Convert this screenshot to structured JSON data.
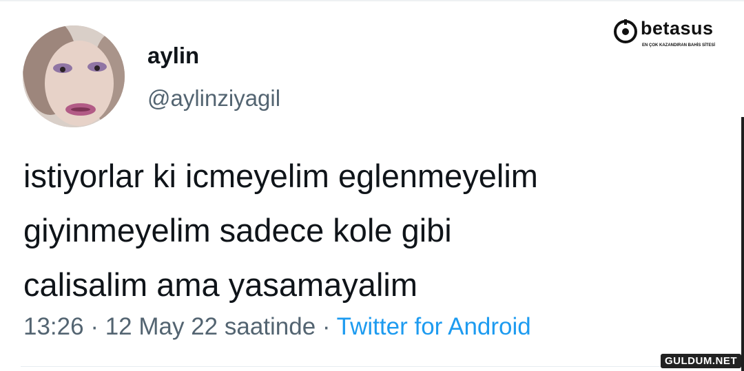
{
  "tweet": {
    "display_name": "aylin",
    "handle": "@aylinziyagil",
    "text_lines": [
      "istiyorlar ki icmeyelim eglenmeyelim",
      "giyinmeyelim sadece kole gibi",
      "calisalim ama yasamayalim"
    ],
    "time": "13:26",
    "separator": " · ",
    "date": "12 May 22 saatinde",
    "source": "Twitter for Android"
  },
  "overlay": {
    "brand_name": "betasus",
    "brand_tagline": "EN ÇOK KAZANDIRAN BAHİS SİTESİ",
    "brand_icon": "target-logo-icon",
    "watermark": "GULDUM.NET"
  },
  "colors": {
    "text": "#0f1419",
    "secondary": "#536471",
    "link": "#1d9bf0"
  }
}
